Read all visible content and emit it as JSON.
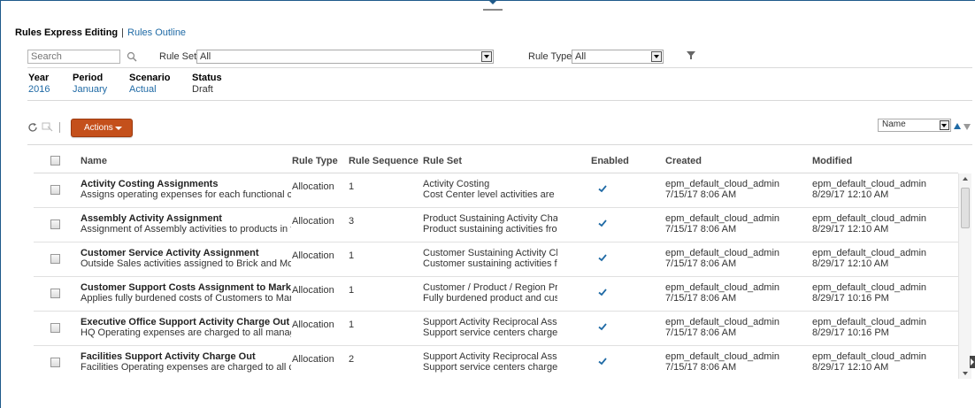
{
  "nav": {
    "active_tab": "Rules Express Editing",
    "separator": "|",
    "other_tab": "Rules Outline"
  },
  "filters": {
    "search_placeholder": "Search",
    "rule_set_label": "Rule Set",
    "rule_set_value": "All",
    "rule_type_label": "Rule Type",
    "rule_type_value": "All"
  },
  "pov": [
    {
      "key": "Year",
      "value": "2016"
    },
    {
      "key": "Period",
      "value": "January"
    },
    {
      "key": "Scenario",
      "value": "Actual"
    },
    {
      "key": "Status",
      "value": "Draft"
    }
  ],
  "toolbar": {
    "actions_label": "Actions",
    "sort_value": "Name"
  },
  "columns": {
    "name": "Name",
    "rule_type": "Rule Type",
    "rule_sequence": "Rule Sequence",
    "rule_set": "Rule Set",
    "enabled": "Enabled",
    "created": "Created",
    "modified": "Modified"
  },
  "rows": [
    {
      "name": "Activity Costing Assignments",
      "desc": "Assigns operating expenses for each functional cost c",
      "rule_type": "Allocation",
      "sequence": "1",
      "rule_set": "Activity Costing",
      "rule_set_desc": "Cost Center level activities are cos",
      "created_by": "epm_default_cloud_admin",
      "created_at": "7/15/17 8:06 AM",
      "modified_by": "epm_default_cloud_admin",
      "modified_at": "8/29/17 12:10 AM"
    },
    {
      "name": "Assembly Activity Assignment",
      "desc": "Assignment of Assembly activities to products in the B",
      "rule_type": "Allocation",
      "sequence": "3",
      "rule_set": "Product Sustaining Activity Charge",
      "rule_set_desc": "Product sustaining activities from c",
      "created_by": "epm_default_cloud_admin",
      "created_at": "7/15/17 8:06 AM",
      "modified_by": "epm_default_cloud_admin",
      "modified_at": "8/29/17 12:10 AM"
    },
    {
      "name": "Customer Service Activity Assignment",
      "desc": "Outside Sales activities assigned to Brick and Mortar c",
      "rule_type": "Allocation",
      "sequence": "1",
      "rule_set": "Customer Sustaining Activity Charg",
      "rule_set_desc": "Customer sustaining activities from",
      "created_by": "epm_default_cloud_admin",
      "created_at": "7/15/17 8:06 AM",
      "modified_by": "epm_default_cloud_admin",
      "modified_at": "8/29/17 12:10 AM"
    },
    {
      "name": "Customer Support Costs Assignment to Market I",
      "desc": "Applies fully burdened costs of Customers to Market i",
      "rule_type": "Allocation",
      "sequence": "1",
      "rule_set": "Customer / Product / Region Profit",
      "rule_set_desc": "Fully burdened product and custor",
      "created_by": "epm_default_cloud_admin",
      "created_at": "7/15/17 8:06 AM",
      "modified_by": "epm_default_cloud_admin",
      "modified_at": "8/29/17 10:16 PM"
    },
    {
      "name": "Executive Office Support Activity Charge Out",
      "desc": "HQ Operating expenses are charged to all managed c",
      "rule_type": "Allocation",
      "sequence": "1",
      "rule_set": "Support Activity Reciprocal Assigni",
      "rule_set_desc": "Support service centers charge ou",
      "created_by": "epm_default_cloud_admin",
      "created_at": "7/15/17 8:06 AM",
      "modified_by": "epm_default_cloud_admin",
      "modified_at": "8/29/17 10:16 PM"
    },
    {
      "name": "Facilities Support Activity Charge Out",
      "desc": "Facilities Operating expenses are charged to all cons",
      "rule_type": "Allocation",
      "sequence": "2",
      "rule_set": "Support Activity Reciprocal Assigni",
      "rule_set_desc": "Support service centers charge ou",
      "created_by": "epm_default_cloud_admin",
      "created_at": "7/15/17 8:06 AM",
      "modified_by": "epm_default_cloud_admin",
      "modified_at": "8/29/17 12:10 AM"
    }
  ]
}
